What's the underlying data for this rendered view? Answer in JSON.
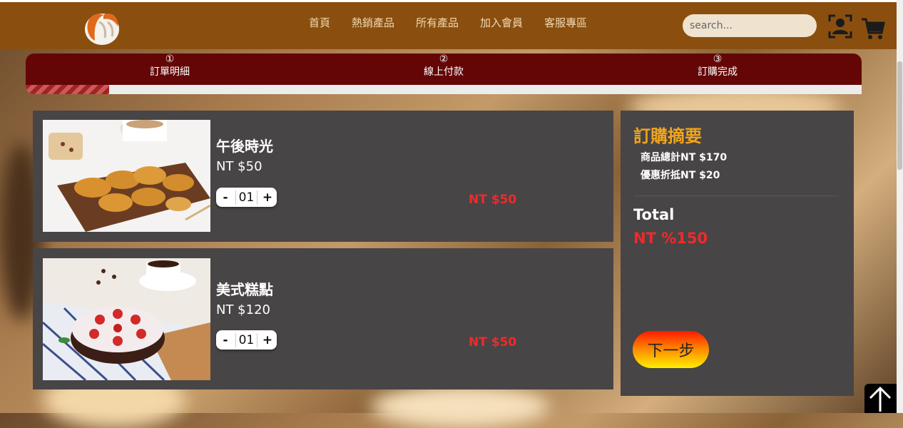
{
  "header": {
    "nav": [
      "首頁",
      "熱銷產品",
      "所有產品",
      "加入會員",
      "客服專區"
    ],
    "search_placeholder": "search..."
  },
  "icons": {
    "logo": "bread-logo-icon",
    "user": "user-account-icon",
    "cart": "shopping-cart-icon",
    "back_to_top": "arrow-up-icon"
  },
  "steps": [
    {
      "num": "①",
      "label": "訂單明細"
    },
    {
      "num": "②",
      "label": "線上付款"
    },
    {
      "num": "③",
      "label": "訂購完成"
    }
  ],
  "progress_fraction": 0.1,
  "items": [
    {
      "name": "午後時光",
      "price": "NT $50",
      "qty": "01",
      "line_total": "NT $50",
      "minus": "-",
      "plus": "+"
    },
    {
      "name": "美式糕點",
      "price": "NT $120",
      "qty": "01",
      "line_total": "NT $50",
      "minus": "-",
      "plus": "+"
    }
  ],
  "summary": {
    "title": "訂購摘要",
    "subtotal": "商品總計NT $170",
    "discount": "優惠折抵NT $20",
    "total_label": "Total",
    "total_value": "NT %150",
    "next_label": "下一步"
  },
  "colors": {
    "header": "#8a4f0f",
    "steps_bar": "#640606",
    "card": "#474546",
    "accent_orange": "#f0a51d",
    "price_red": "#ee2b2b"
  }
}
